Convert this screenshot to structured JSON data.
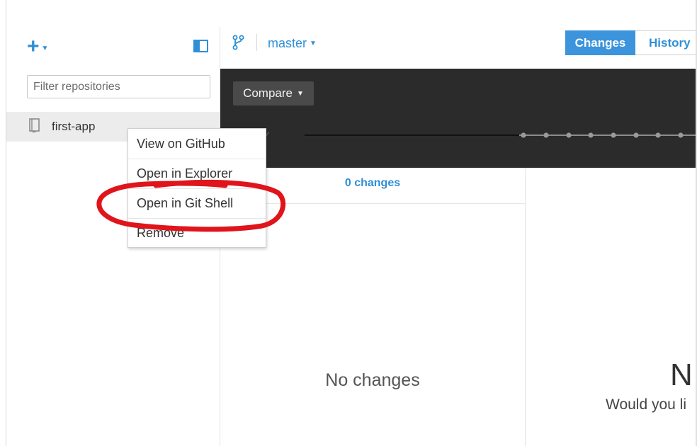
{
  "sidebar": {
    "add_icon": "plus-icon",
    "toggle_icon": "sidebar-toggle-icon",
    "filter_placeholder": "Filter repositories",
    "repos": [
      {
        "label": "first-app",
        "icon": "repository-icon"
      }
    ]
  },
  "context_menu": {
    "items": [
      {
        "label": "View on GitHub"
      },
      {
        "label": "Open in Explorer"
      },
      {
        "label": "Open in Git Shell"
      },
      {
        "label": "Remove"
      }
    ],
    "highlighted_item": "Open in Git Shell",
    "annotation_color": "#e0141b"
  },
  "toolbar": {
    "branch_icon": "branch-icon",
    "branch_name": "master",
    "tabs": [
      {
        "label": "Changes",
        "active": true
      },
      {
        "label": "History",
        "active": false
      }
    ]
  },
  "timeline": {
    "compare_label": "Compare"
  },
  "changes": {
    "count_label": "0 changes",
    "empty_message": "No changes"
  },
  "detail": {
    "heading_fragment": "N",
    "prompt_fragment": "Would you li"
  },
  "colors": {
    "accent": "#2f8fd6",
    "active_tab": "#3b94dc",
    "dark_bar": "#2b2b2b",
    "selected_row": "#ececec"
  }
}
